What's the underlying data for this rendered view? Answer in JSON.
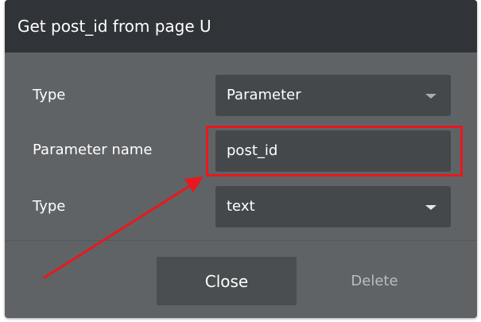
{
  "dialog": {
    "title": "Get post_id from page U"
  },
  "rows": [
    {
      "label": "Type",
      "value": "Parameter",
      "control": "dropdown"
    },
    {
      "label": "Parameter name",
      "value": "post_id",
      "control": "text-input"
    },
    {
      "label": "Type",
      "value": "text",
      "control": "dropdown"
    }
  ],
  "footer": {
    "close_label": "Close",
    "delete_label": "Delete"
  },
  "colors": {
    "header_background": "#303438",
    "dialog_background": "#5f6366",
    "field_background": "#44484b",
    "annotation_red": "#e8181e"
  }
}
